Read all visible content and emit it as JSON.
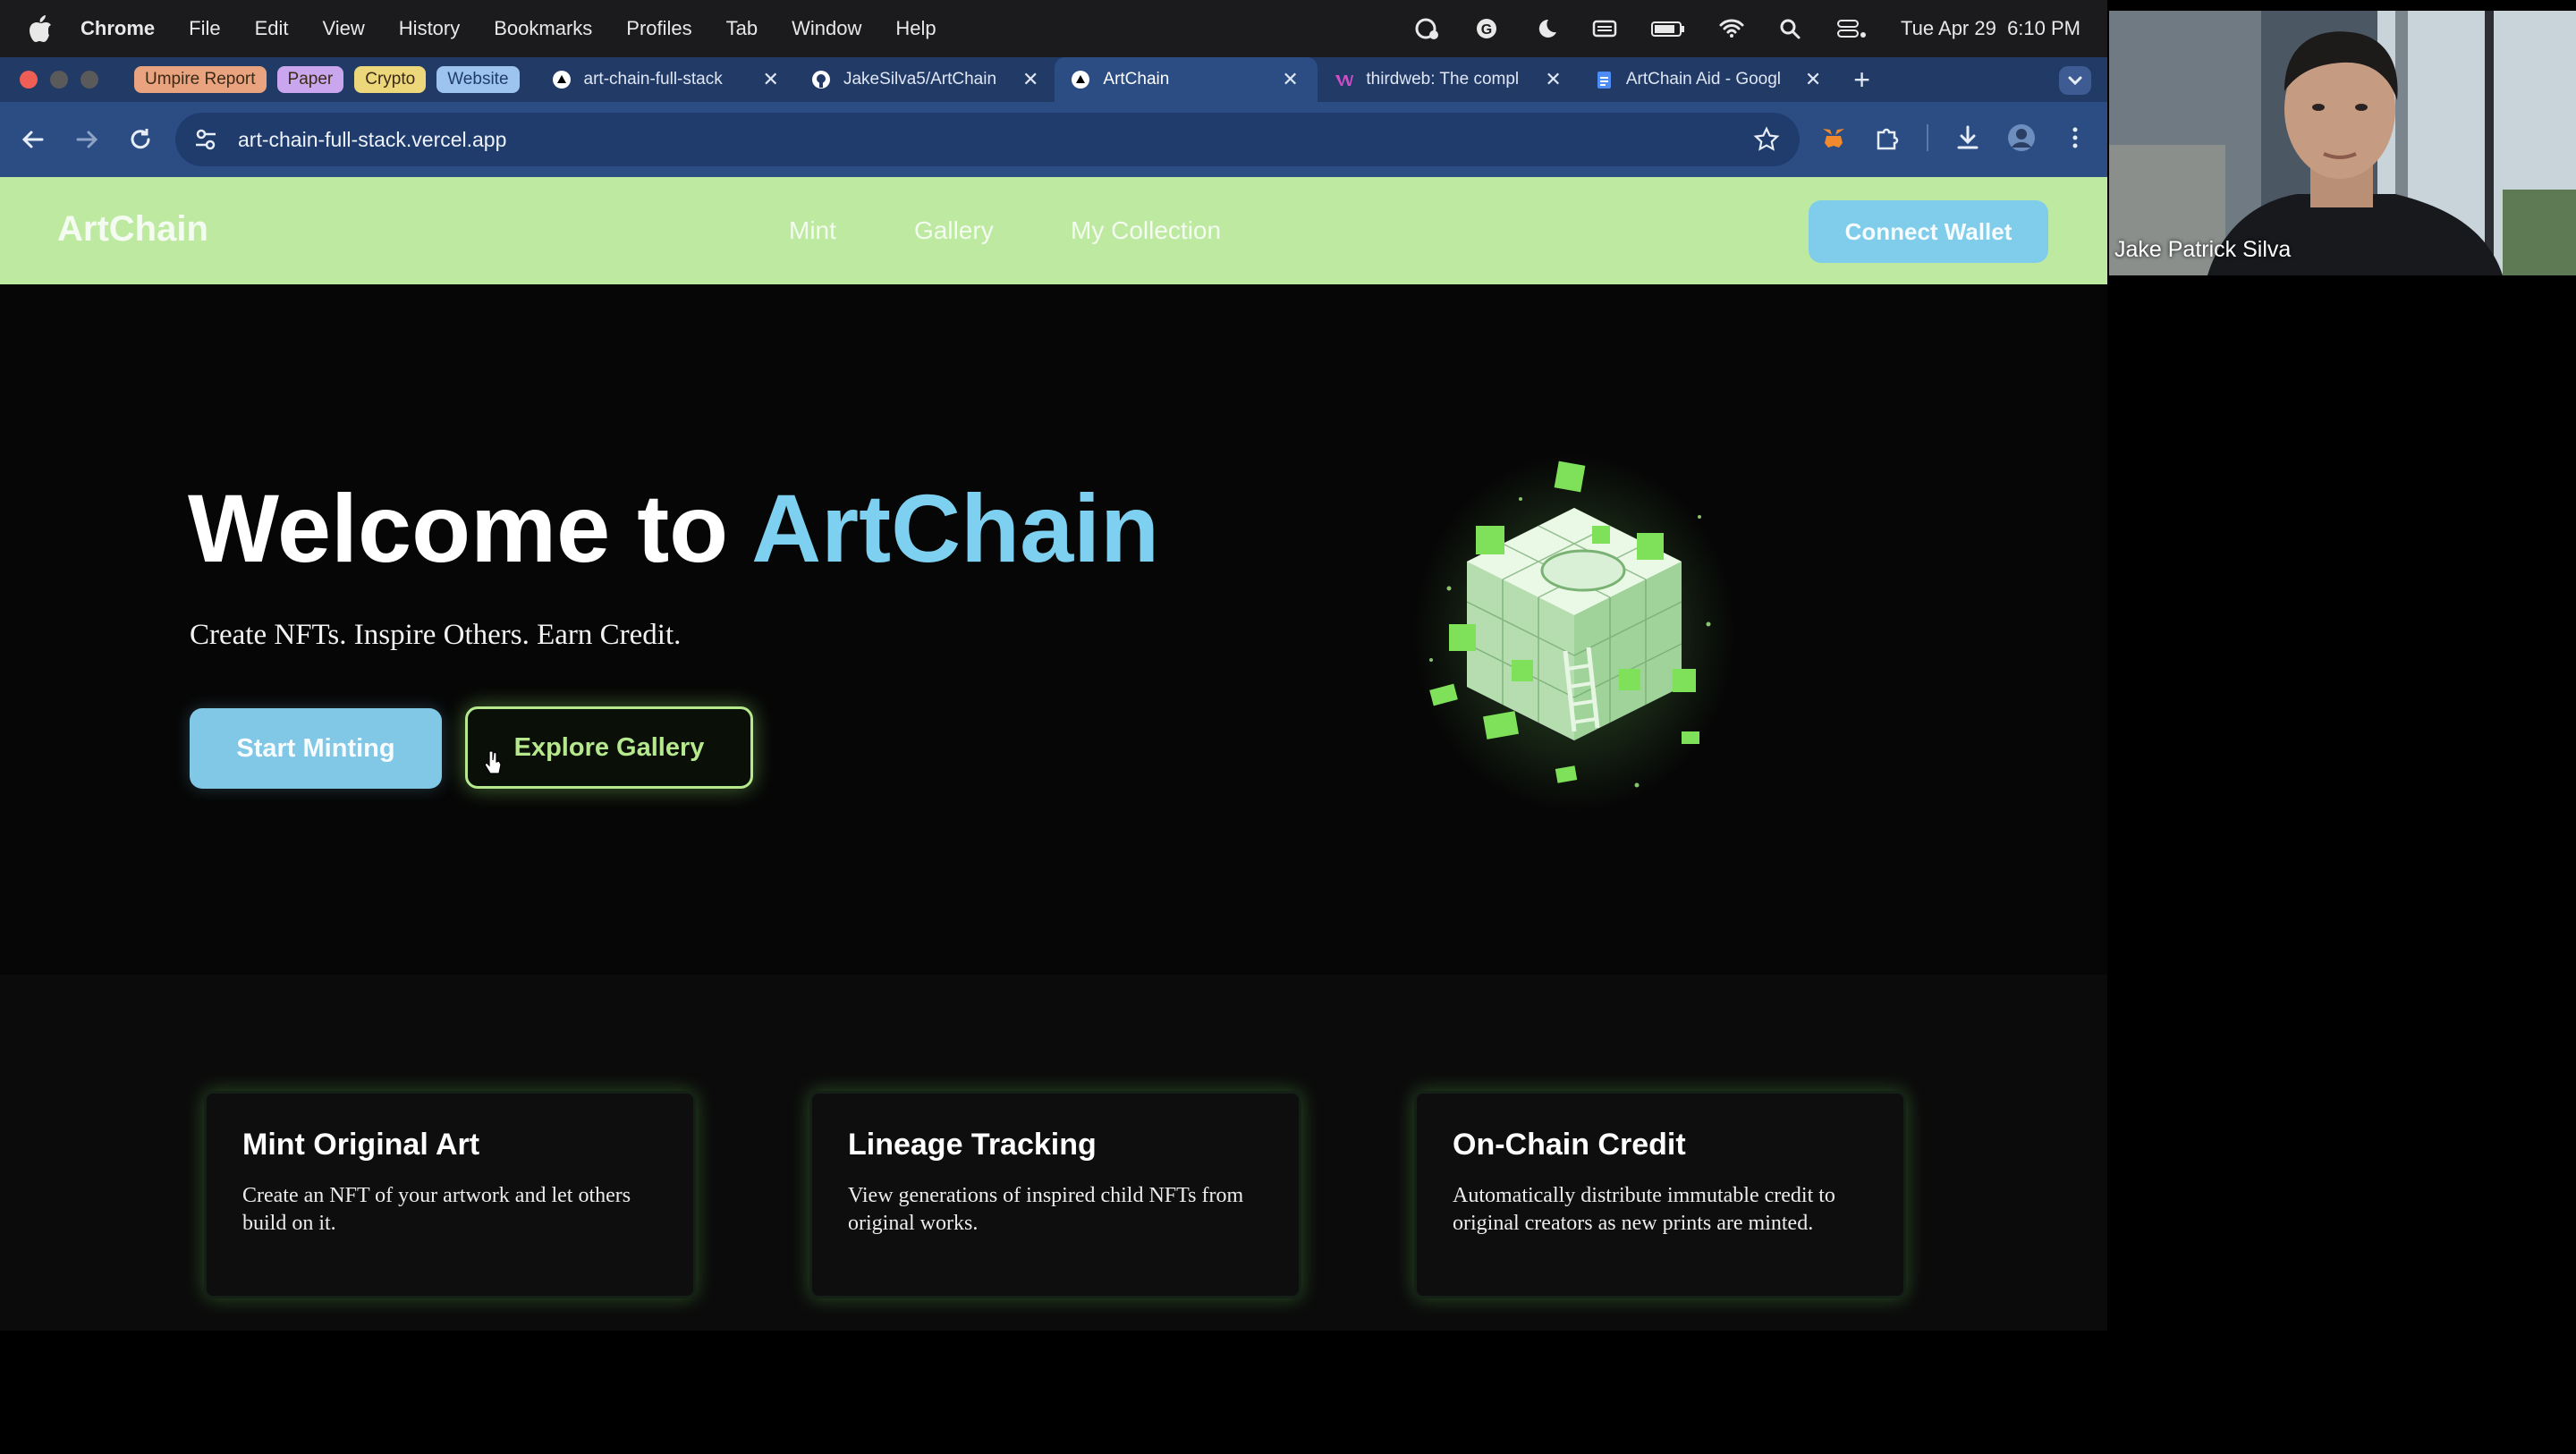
{
  "menubar": {
    "app": "Chrome",
    "menus": [
      "File",
      "Edit",
      "View",
      "History",
      "Bookmarks",
      "Profiles",
      "Tab",
      "Window",
      "Help"
    ],
    "clock": "Tue Apr 29  6:10 PM"
  },
  "tab_groups": [
    {
      "label": "Umpire Report",
      "color": "#e9a37f"
    },
    {
      "label": "Paper",
      "color": "#c9a6ee"
    },
    {
      "label": "Crypto",
      "color": "#ecd77a"
    },
    {
      "label": "Website",
      "color": "#9dc4ef"
    }
  ],
  "tabs": [
    {
      "title": "art-chain-full-stack",
      "icon": "vercel-icon"
    },
    {
      "title": "JakeSilva5/ArtChain",
      "icon": "github-icon"
    },
    {
      "title": "ArtChain",
      "icon": "vercel-icon",
      "active": true
    },
    {
      "title": "thirdweb: The compl",
      "icon": "thirdweb-icon"
    },
    {
      "title": "ArtChain Aid - Googl",
      "icon": "google-docs-icon"
    }
  ],
  "address": {
    "url": "art-chain-full-stack.vercel.app"
  },
  "site": {
    "logo": "ArtChain",
    "nav": [
      "Mint",
      "Gallery",
      "My Collection"
    ],
    "connect_label": "Connect Wallet",
    "accent_color": "#7dd0ef",
    "nav_bg": "#bde9a0"
  },
  "hero": {
    "title_prefix": "Welcome to ",
    "title_accent": "ArtChain",
    "subtitle": "Create NFTs. Inspire Others. Earn Credit.",
    "primary_button": "Start Minting",
    "secondary_button": "Explore Gallery"
  },
  "features": [
    {
      "title": "Mint Original Art",
      "description": "Create an NFT of your artwork and let others build on it."
    },
    {
      "title": "Lineage Tracking",
      "description": "View generations of inspired child NFTs from original works."
    },
    {
      "title": "On-Chain Credit",
      "description": "Automatically distribute immutable credit to original creators as new prints are minted."
    }
  ],
  "video_call": {
    "participant_name": "Jake Patrick Silva"
  }
}
